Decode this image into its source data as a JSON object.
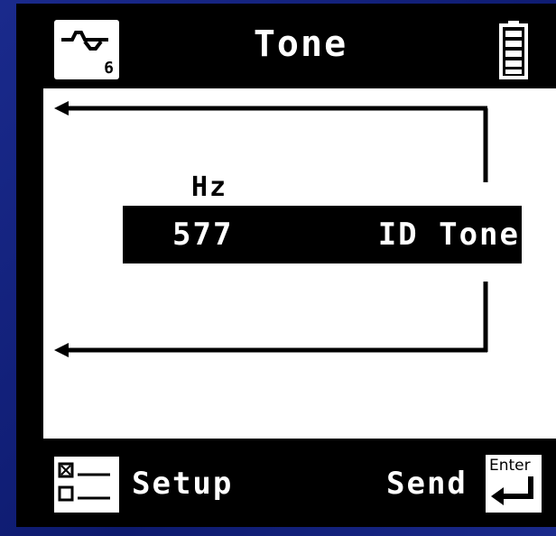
{
  "title_bar": {
    "title": "Tone",
    "mode_icon": "sine-wave-mode-icon",
    "mode_number": "6",
    "battery_icon": "battery-full-icon"
  },
  "main": {
    "unit_label": "Hz",
    "frequency_value": "577",
    "tone_type": "ID Tone",
    "left_arrow_icon": "arrow-left-icon"
  },
  "softkeys": {
    "left_label": "Setup",
    "left_icon": "setup-checklist-icon",
    "right_label": "Send",
    "right_icon": "enter-key-icon",
    "enter_text": "Enter"
  },
  "colors": {
    "background": "#1a2a8c",
    "screen_dark": "#000000",
    "screen_light": "#ffffff"
  }
}
